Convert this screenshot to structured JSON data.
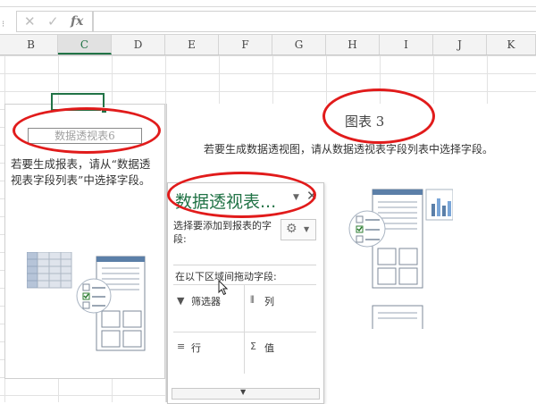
{
  "formula_bar": {
    "cancel_icon": "x-icon",
    "enter_icon": "check-icon",
    "fx_label": "fx",
    "value": ""
  },
  "columns": [
    {
      "label": "B",
      "selected": false
    },
    {
      "label": "C",
      "selected": true
    },
    {
      "label": "D",
      "selected": false
    },
    {
      "label": "E",
      "selected": false
    },
    {
      "label": "F",
      "selected": false
    },
    {
      "label": "G",
      "selected": false
    },
    {
      "label": "H",
      "selected": false
    },
    {
      "label": "I",
      "selected": false
    },
    {
      "label": "J",
      "selected": false
    },
    {
      "label": "K",
      "selected": false
    }
  ],
  "pivot_table": {
    "title": "数据透视表6",
    "description": "若要生成报表，请从“数据透视表字段列表”中选择字段。"
  },
  "pivot_chart": {
    "title": "图表 3",
    "hint": "若要生成数据透视图，请从数据透视表字段列表中选择字段。"
  },
  "field_pane": {
    "title": "数据透视表...",
    "choose_label": "选择要添加到报表的字段:",
    "drag_label": "在以下区域间拖动字段:",
    "areas": {
      "filters": "筛选器",
      "columns": "列",
      "rows": "行",
      "values": "值"
    }
  },
  "colors": {
    "excel_green": "#217346",
    "highlight_red": "#e11b1b"
  }
}
